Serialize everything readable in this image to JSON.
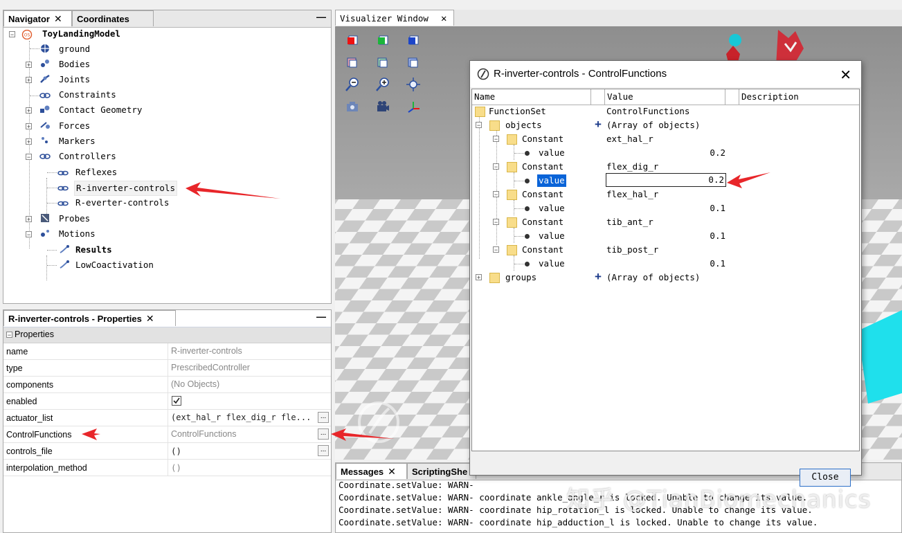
{
  "navigator": {
    "tabs": [
      {
        "label": "Navigator"
      },
      {
        "label": "Coordinates"
      }
    ],
    "tree": [
      {
        "label": "ToyLandingModel",
        "bold": true
      },
      {
        "label": "ground"
      },
      {
        "label": "Bodies"
      },
      {
        "label": "Joints"
      },
      {
        "label": "Constraints"
      },
      {
        "label": "Contact Geometry"
      },
      {
        "label": "Forces"
      },
      {
        "label": "Markers"
      },
      {
        "label": "Controllers"
      },
      {
        "label": "Reflexes"
      },
      {
        "label": "R-inverter-controls"
      },
      {
        "label": "R-everter-controls"
      },
      {
        "label": "Probes"
      },
      {
        "label": "Motions"
      },
      {
        "label": "Results",
        "bold": true
      },
      {
        "label": "LowCoactivation"
      }
    ]
  },
  "properties": {
    "tab": "R-inverter-controls - Properties",
    "section": "Properties",
    "rows": [
      {
        "key": "name",
        "value": "R-inverter-controls"
      },
      {
        "key": "type",
        "value": "PrescribedController"
      },
      {
        "key": "components",
        "value": "(No Objects)"
      },
      {
        "key": "enabled",
        "value": ""
      },
      {
        "key": "actuator_list",
        "value": "(ext_hal_r flex_dig_r fle..."
      },
      {
        "key": "ControlFunctions",
        "value": "ControlFunctions"
      },
      {
        "key": "controls_file",
        "value": "()"
      },
      {
        "key": "interpolation_method",
        "value": "()"
      }
    ]
  },
  "visualizer": {
    "tab": "Visualizer Window"
  },
  "messages": {
    "tabs": [
      {
        "label": "Messages"
      },
      {
        "label": "ScriptingShe"
      }
    ],
    "lines": [
      "Coordinate.setValue: WARN-",
      "Coordinate.setValue: WARN- coordinate ankle_angle_r is locked. Unable to change its value.",
      "Coordinate.setValue: WARN- coordinate hip_rotation_l is locked. Unable to change its value.",
      "Coordinate.setValue: WARN- coordinate hip_adduction_l is locked. Unable to change its value."
    ]
  },
  "dialog": {
    "title": "R-inverter-controls - ControlFunctions",
    "columns": [
      "Name",
      "Value",
      "Description"
    ],
    "rows": [
      {
        "name": "FunctionSet",
        "value": "ControlFunctions"
      },
      {
        "name": "objects",
        "value": "(Array of objects)"
      },
      {
        "name": "Constant",
        "value": "ext_hal_r"
      },
      {
        "name": "value",
        "value": "0.2"
      },
      {
        "name": "Constant",
        "value": "flex_dig_r"
      },
      {
        "name": "value",
        "value": "0.2"
      },
      {
        "name": "Constant",
        "value": "flex_hal_r"
      },
      {
        "name": "value",
        "value": "0.1"
      },
      {
        "name": "Constant",
        "value": "tib_ant_r"
      },
      {
        "name": "value",
        "value": "0.1"
      },
      {
        "name": "Constant",
        "value": "tib_post_r"
      },
      {
        "name": "value",
        "value": "0.1"
      },
      {
        "name": "groups",
        "value": "(Array of objects)"
      }
    ],
    "close_label": "Close"
  },
  "watermark": "知乎 @TianBiomechanics",
  "colors": {
    "arrow": "#e8262a",
    "selection": "#0a64d8",
    "folder": "#f8dd8a"
  }
}
